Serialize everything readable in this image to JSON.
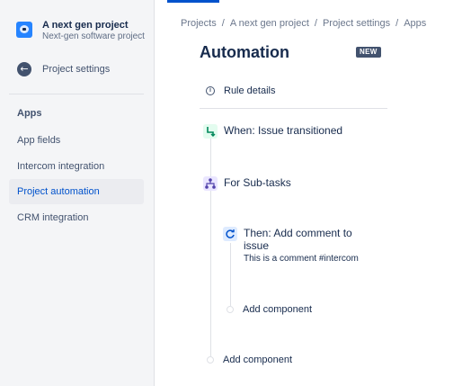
{
  "sidebar": {
    "project_name": "A next gen project",
    "project_type": "Next-gen software project",
    "back_label": "Project settings",
    "section_title": "Apps",
    "items": [
      {
        "label": "App fields"
      },
      {
        "label": "Intercom integration"
      },
      {
        "label": "Project automation",
        "active": true
      },
      {
        "label": "CRM integration"
      }
    ]
  },
  "breadcrumb": [
    "Projects",
    "A next gen project",
    "Project settings",
    "Apps"
  ],
  "page": {
    "title": "Automation",
    "badge": "NEW"
  },
  "rule": {
    "details_label": "Rule details",
    "trigger": "When: Issue transitioned",
    "branch": "For Sub-tasks",
    "action_title": "Then: Add comment to issue",
    "action_detail": "This is a comment #intercom",
    "add_inner": "Add component",
    "add_outer": "Add component"
  },
  "colors": {
    "accent": "#0052cc",
    "trigger_icon_bg": "#e3fcef",
    "trigger_icon_fg": "#00875a",
    "branch_icon_bg": "#eae6ff",
    "branch_icon_fg": "#5243aa",
    "action_icon_bg": "#deebff",
    "action_icon_fg": "#0052cc"
  }
}
